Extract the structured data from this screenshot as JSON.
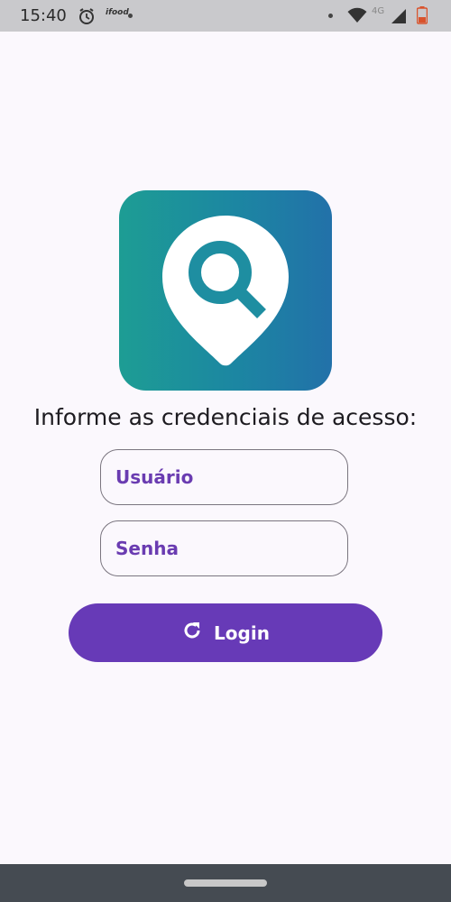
{
  "status_bar": {
    "time": "15:40",
    "app_notification": "ifood",
    "network": "4G",
    "icons": [
      "alarm-icon",
      "ifood-icon",
      "wifi-icon",
      "signal-icon",
      "battery-icon"
    ]
  },
  "logo": {
    "icon": "location-search-icon",
    "gradient": [
      "#1d9d94",
      "#2271a9"
    ]
  },
  "form": {
    "prompt": "Informe as credenciais de acesso:",
    "username_placeholder": "Usuário",
    "password_placeholder": "Senha",
    "login_label": "Login",
    "login_icon": "refresh-icon"
  },
  "colors": {
    "accent": "#673ab7",
    "placeholder": "#6a3cb1",
    "background": "#fbf8fd"
  }
}
